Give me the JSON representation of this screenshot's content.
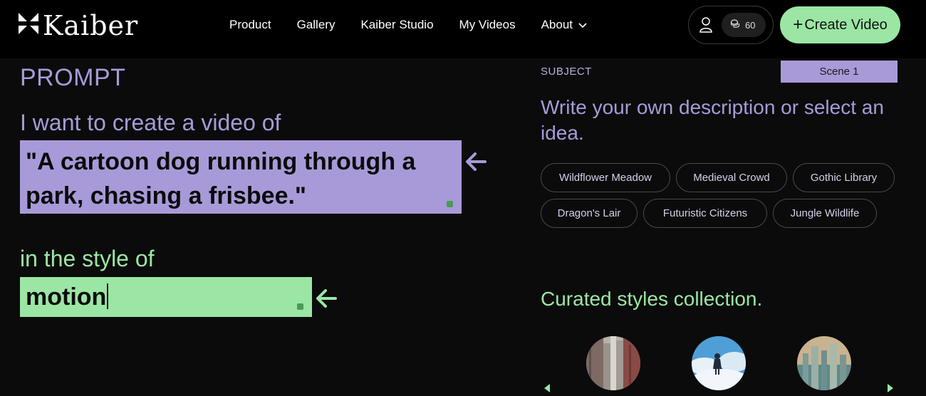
{
  "brand": {
    "name": "Kaiber",
    "logo_icon": "kaiber-logo-icon"
  },
  "nav": {
    "links": [
      "Product",
      "Gallery",
      "Kaiber Studio",
      "My Videos"
    ],
    "about_label": "About",
    "credits": "60",
    "create_label": "Create Video"
  },
  "prompt": {
    "heading": "PROMPT",
    "intro": "I want to create a video of",
    "subject_text": "\"A cartoon dog running through a park, chasing a frisbee.\"",
    "style_intro": "in the style of",
    "style_value": "motion"
  },
  "subject_panel": {
    "label": "SUBJECT",
    "scene": "Scene 1",
    "description": "Write your own description or select an idea.",
    "ideas": [
      "Wildflower Meadow",
      "Medieval Crowd",
      "Gothic Library",
      "Dragon's Lair",
      "Futuristic Citizens",
      "Jungle Wildlife"
    ]
  },
  "styles_panel": {
    "heading": "Curated styles collection."
  },
  "colors": {
    "purple": "#a89ad8",
    "green": "#9be6a4",
    "background": "#0b0b0b"
  }
}
